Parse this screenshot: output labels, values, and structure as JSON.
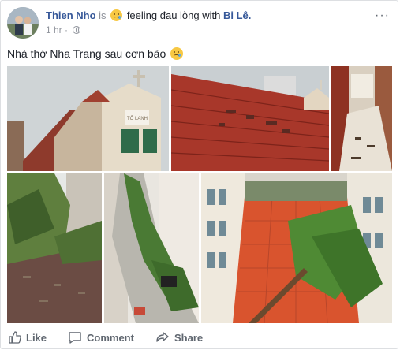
{
  "post": {
    "author": "Thien Nho",
    "is_text": "is",
    "feeling_text": "feeling đau lòng with",
    "tagged": "Bi Lê.",
    "time": "1 hr",
    "message": "Nhà thờ Nha Trang sau cơn bão"
  },
  "icons": {
    "feeling_emoji": "sad-tear-emoji-icon",
    "message_emoji": "sad-tear-emoji-icon",
    "privacy": "globe-icon",
    "more": "more-options-icon"
  },
  "photos": [
    {
      "label": "church-with-damaged-roof"
    },
    {
      "label": "red-tile-roof-damaged"
    },
    {
      "label": "balcony-debris"
    },
    {
      "label": "courtyard-fallen-trees"
    },
    {
      "label": "alley-with-tree-debris"
    },
    {
      "label": "red-tile-courtyard-fallen-tree"
    }
  ],
  "church_sign": "TỔ LANH",
  "actions": {
    "like": "Like",
    "comment": "Comment",
    "share": "Share"
  }
}
